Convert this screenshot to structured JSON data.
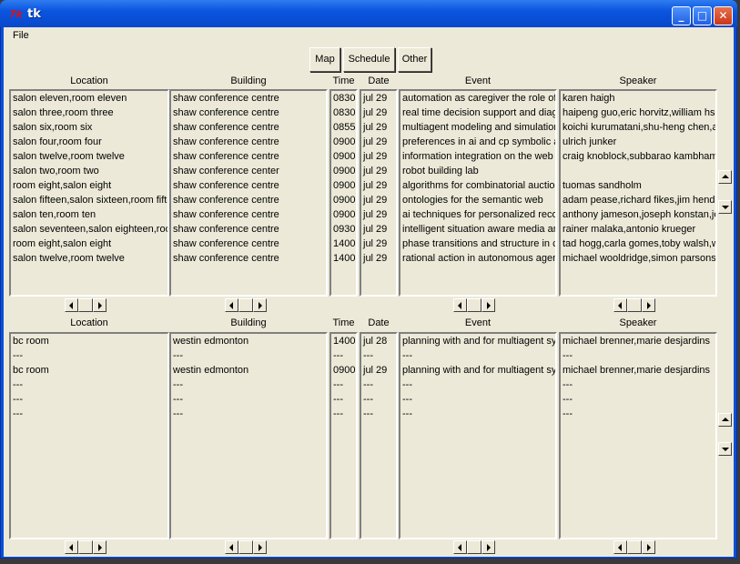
{
  "window": {
    "title": "tk",
    "icon": "tk-feather-icon"
  },
  "menu": {
    "file": "File"
  },
  "toolbar": {
    "map": "Map",
    "schedule": "Schedule",
    "other": "Other"
  },
  "headers": {
    "location": "Location",
    "building": "Building",
    "time": "Time",
    "date": "Date",
    "event": "Event",
    "speaker": "Speaker"
  },
  "top_table": {
    "location": [
      "salon eleven,room eleven",
      "salon three,room three",
      "salon six,room six",
      "salon four,room four",
      "salon twelve,room twelve",
      "salon two,room two",
      "room eight,salon eight",
      "salon fifteen,salon sixteen,room fifteen",
      "salon ten,room ten",
      "salon seventeen,salon eighteen,room",
      "room eight,salon eight",
      "salon twelve,room twelve"
    ],
    "building": [
      "shaw conference centre",
      "shaw conference centre",
      "shaw conference centre",
      "shaw conference centre",
      "shaw conference centre",
      "shaw conference center",
      "shaw conference centre",
      "shaw conference centre",
      "shaw conference centre",
      "shaw conference centre",
      "shaw conference centre",
      "shaw conference centre"
    ],
    "time": [
      "0830",
      "0830",
      "0855",
      "0900",
      "0900",
      "0900",
      "0900",
      "0900",
      "0900",
      "0930",
      "1400",
      "1400"
    ],
    "date": [
      "jul 29",
      "jul 29",
      "jul 29",
      "jul 29",
      "jul 29",
      "jul 29",
      "jul 29",
      "jul 29",
      "jul 29",
      "jul 29",
      "jul 29",
      "jul 29"
    ],
    "event": [
      "automation as caregiver the role of i",
      "real time decision support and diagn",
      "multiagent modeling and simulation c",
      "preferences in ai and cp symbolic ap",
      "information integration on the web",
      "robot building lab",
      "algorithms for combinatorial auctions",
      "ontologies for the semantic web",
      "ai techniques for personalized recon",
      "intelligent situation aware media and",
      "phase transitions and structure in cc",
      "rational action in autonomous agent"
    ],
    "speaker": [
      "karen haigh",
      "haipeng guo,eric horvitz,william hsu,",
      "koichi kurumatani,shu-heng chen,az",
      "ulrich junker",
      "craig knoblock,subbarao kambhamp",
      "",
      "tuomas sandholm",
      "adam pease,richard fikes,jim hendle",
      "anthony jameson,joseph konstan,joh",
      "rainer malaka,antonio krueger",
      "tad hogg,carla gomes,toby walsh,we",
      "michael wooldridge,simon parsons"
    ]
  },
  "bottom_table": {
    "location": [
      "bc room",
      "---",
      "bc room",
      "---",
      "---",
      "---"
    ],
    "building": [
      "westin edmonton",
      "---",
      "westin edmonton",
      "---",
      "---",
      "---"
    ],
    "time": [
      "1400",
      "---",
      "0900",
      "---",
      "---",
      "---"
    ],
    "date": [
      "jul 28",
      "---",
      "jul 29",
      "---",
      "---",
      "---"
    ],
    "event": [
      "planning with and for multiagent syst",
      "---",
      "planning with and for multiagent syst",
      "---",
      "---",
      "---"
    ],
    "speaker": [
      "michael brenner,marie desjardins",
      "---",
      "michael brenner,marie desjardins",
      "---",
      "---",
      "---"
    ]
  }
}
